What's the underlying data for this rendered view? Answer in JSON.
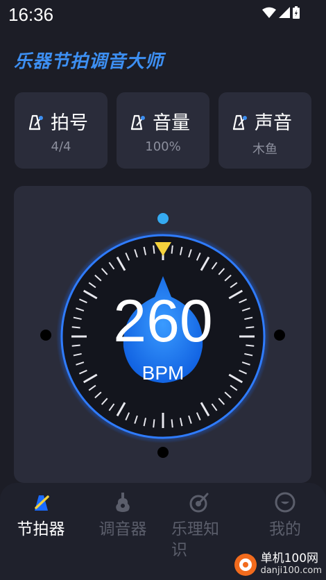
{
  "status_bar": {
    "time": "16:36"
  },
  "app": {
    "title": "乐器节拍调音大师"
  },
  "cards": [
    {
      "label": "拍号",
      "value": "4/4",
      "icon": "metronome-icon"
    },
    {
      "label": "音量",
      "value": "100%",
      "icon": "metronome-icon"
    },
    {
      "label": "声音",
      "value": "木鱼",
      "icon": "metronome-icon"
    }
  ],
  "dial": {
    "bpm": "260",
    "unit": "BPM"
  },
  "nav": {
    "items": [
      {
        "label": "节拍器",
        "icon": "metronome-icon",
        "active": true
      },
      {
        "label": "调音器",
        "icon": "guitar-icon",
        "active": false
      },
      {
        "label": "乐理知识",
        "icon": "music-theory-icon",
        "active": false
      },
      {
        "label": "我的",
        "icon": "profile-icon",
        "active": false
      }
    ]
  },
  "watermark": {
    "name": "单机100网",
    "url": "danji100.com"
  },
  "colors": {
    "accent": "#3d8ff2",
    "background": "#1c1d26",
    "card": "#2a2c3a",
    "pointer": "#f5d23c"
  }
}
